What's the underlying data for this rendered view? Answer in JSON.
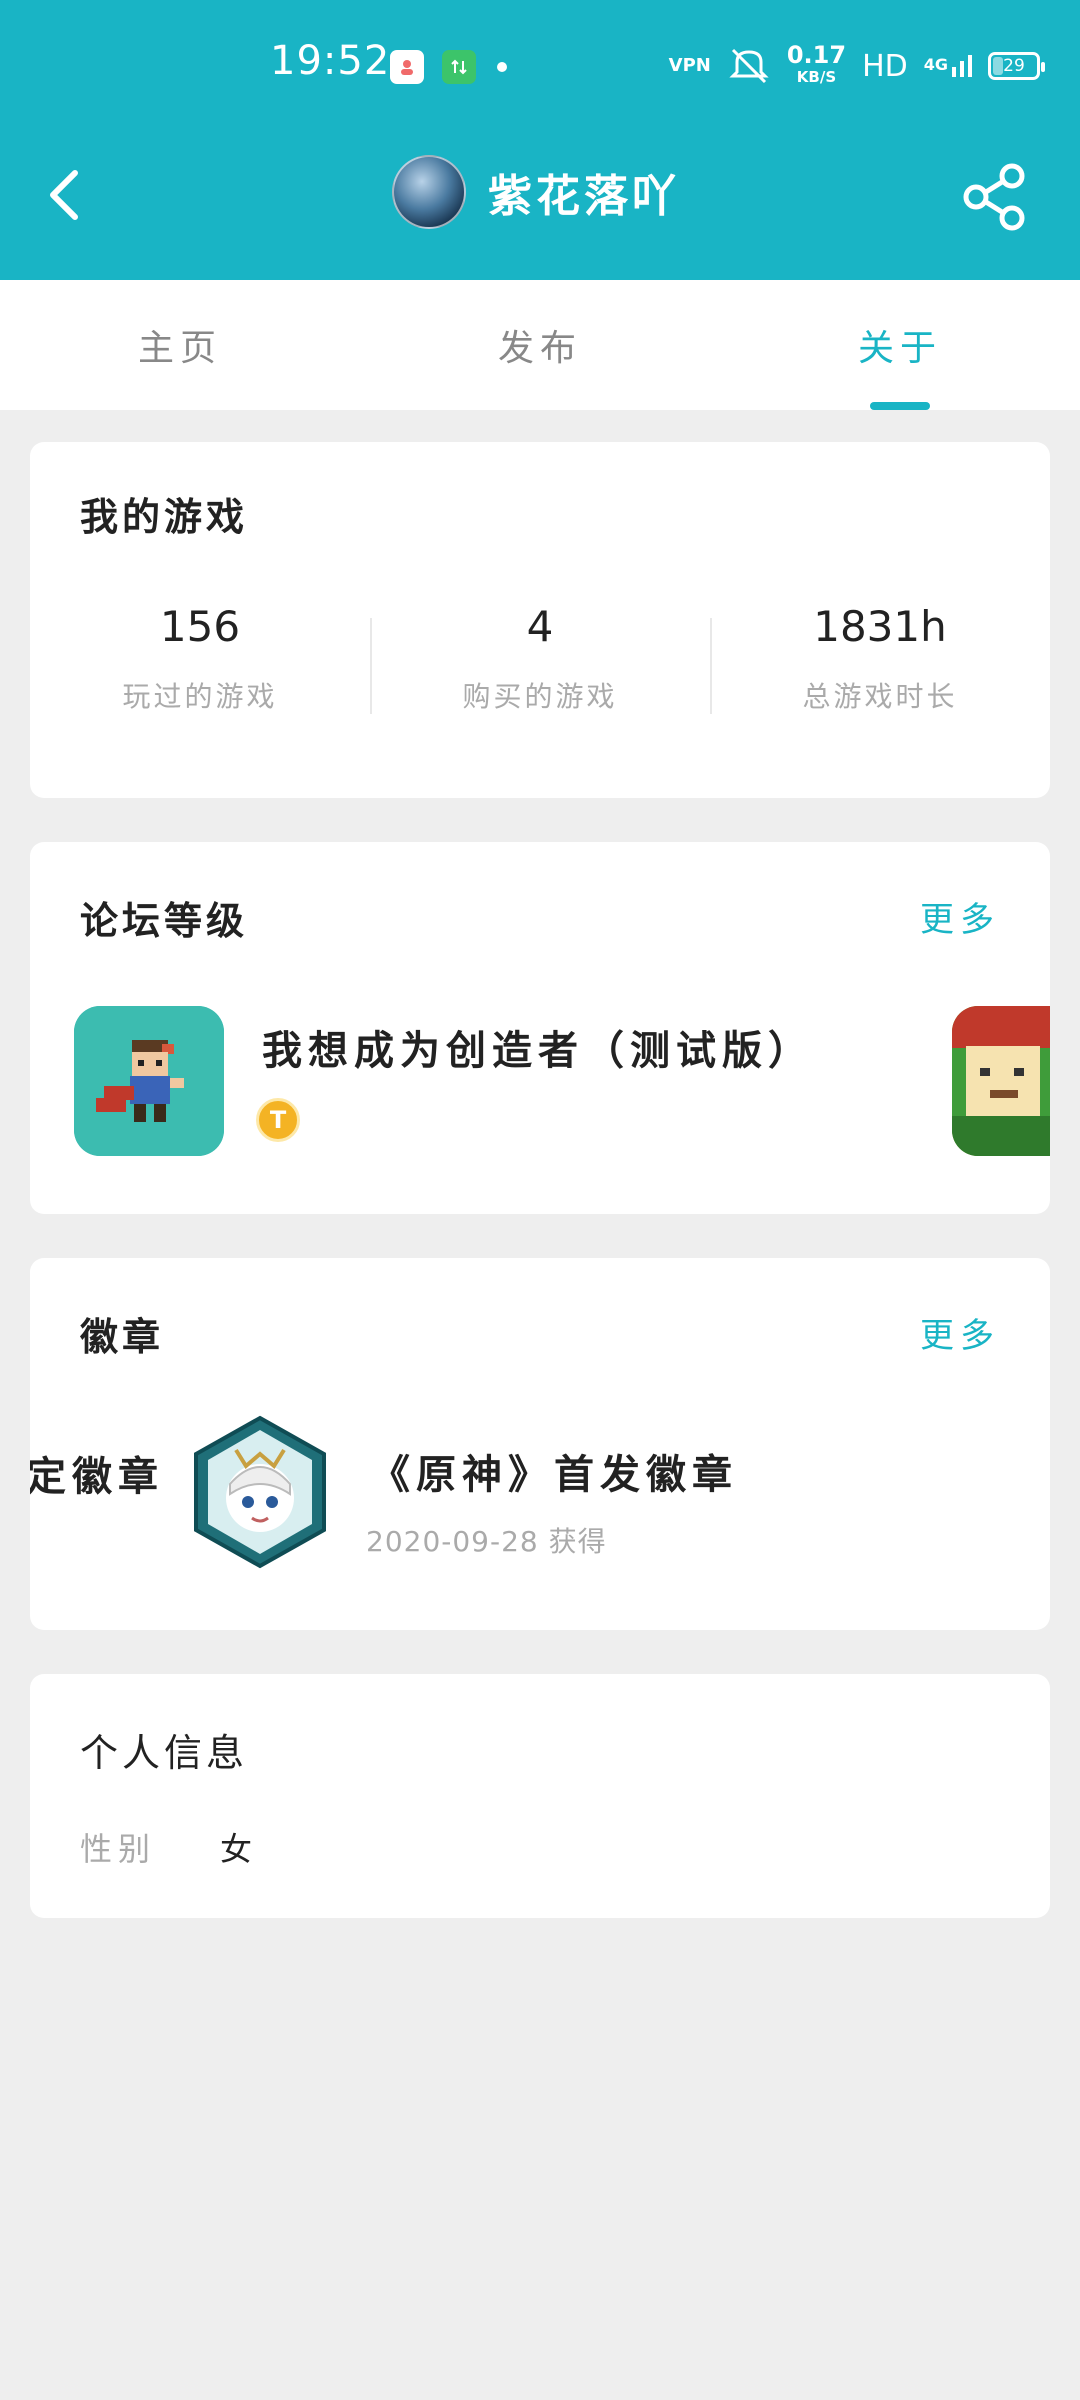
{
  "status_bar": {
    "time": "19:52",
    "network_speed_value": "0.17",
    "network_speed_unit": "KB/S",
    "hd_label": "HD",
    "signal_label": "4G",
    "battery": "29",
    "vpn_label": "VPN"
  },
  "header": {
    "nickname": "紫花落吖"
  },
  "tabs": [
    {
      "label": "主页"
    },
    {
      "label": "发布"
    },
    {
      "label": "关于"
    }
  ],
  "my_games": {
    "title": "我的游戏",
    "stats": [
      {
        "value": "156",
        "label": "玩过的游戏"
      },
      {
        "value": "4",
        "label": "购买的游戏"
      },
      {
        "value": "1831h",
        "label": "总游戏时长"
      }
    ]
  },
  "forum_level": {
    "title": "论坛等级",
    "more": "更多",
    "game_name": "我想成为创造者（测试版）",
    "level_badge": "T"
  },
  "badges": {
    "title": "徽章",
    "more": "更多",
    "partial_name": "定徽章",
    "badge_name": "《原神》首发徽章",
    "badge_date": "2020-09-28 获得"
  },
  "personal_info": {
    "title": "个人信息",
    "gender_label": "性别",
    "gender_value": "女"
  },
  "colors": {
    "accent": "#19b4c5",
    "background": "#eeeeee",
    "card": "#ffffff"
  }
}
